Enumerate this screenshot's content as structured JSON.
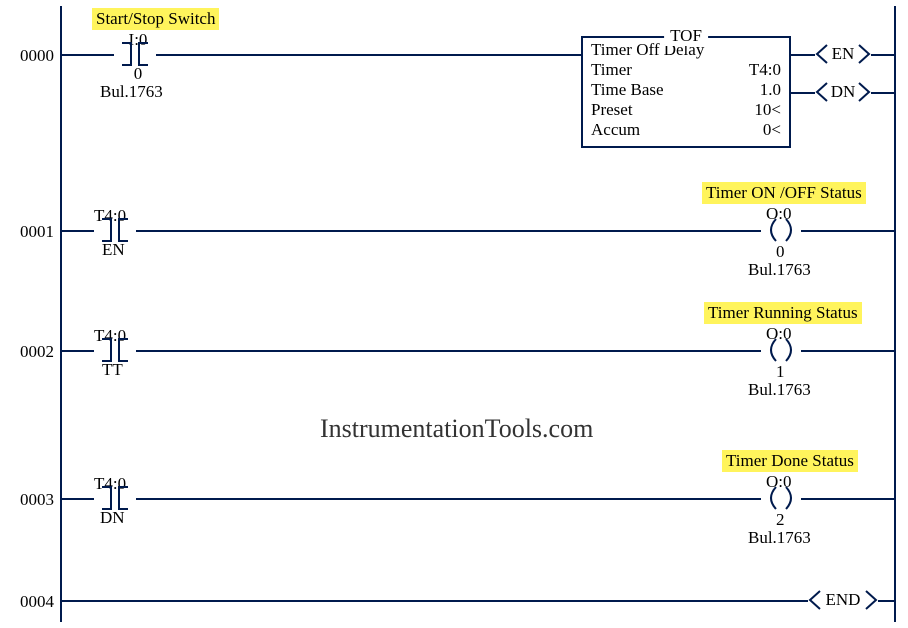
{
  "watermark": "InstrumentationTools.com",
  "rungs": {
    "r0": {
      "num": "0000"
    },
    "r1": {
      "num": "0001"
    },
    "r2": {
      "num": "0002"
    },
    "r3": {
      "num": "0003"
    },
    "r4": {
      "num": "0004"
    }
  },
  "rung0": {
    "comment": "Start/Stop Switch",
    "contact": {
      "tag": "I:0",
      "bit": "0",
      "desc": "Bul.1763"
    },
    "tof": {
      "boxTitle": "TOF",
      "type": "Timer Off Delay",
      "rows": {
        "timer": {
          "k": "Timer",
          "v": "T4:0"
        },
        "timebase": {
          "k": "Time Base",
          "v": "1.0"
        },
        "preset": {
          "k": "Preset",
          "v": "10<"
        },
        "accum": {
          "k": "Accum",
          "v": "0<"
        }
      },
      "enLabel": "EN",
      "dnLabel": "DN"
    }
  },
  "rung1": {
    "comment": "Timer ON /OFF Status",
    "contact": {
      "tag": "T4:0",
      "bit": "EN"
    },
    "coil": {
      "tag": "O:0",
      "bit": "0",
      "desc": "Bul.1763"
    }
  },
  "rung2": {
    "comment": "Timer Running Status",
    "contact": {
      "tag": "T4:0",
      "bit": "TT"
    },
    "coil": {
      "tag": "O:0",
      "bit": "1",
      "desc": "Bul.1763"
    }
  },
  "rung3": {
    "comment": "Timer Done Status",
    "contact": {
      "tag": "T4:0",
      "bit": "DN"
    },
    "coil": {
      "tag": "O:0",
      "bit": "2",
      "desc": "Bul.1763"
    }
  },
  "rung4": {
    "endLabel": "END"
  }
}
